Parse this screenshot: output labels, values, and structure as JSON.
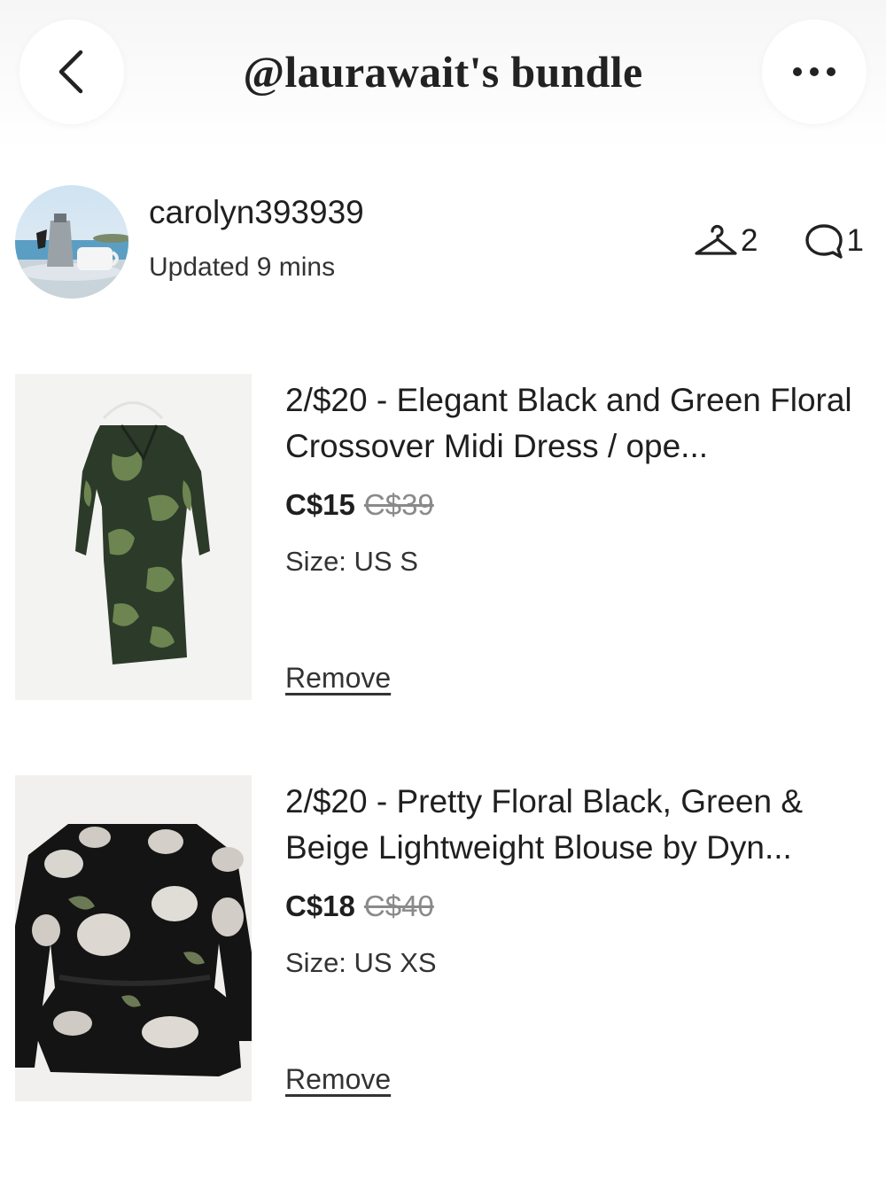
{
  "header": {
    "title": "@laurawait's bundle",
    "back_icon": "chevron-left-icon",
    "more_icon": "more-horizontal-icon"
  },
  "seller": {
    "username": "carolyn393939",
    "updated": "Updated 9 mins"
  },
  "stats": {
    "items_icon": "hanger-icon",
    "items_count": "2",
    "comments_icon": "comment-bubble-icon",
    "comments_count": "1"
  },
  "listings": [
    {
      "title": "2/$20 - Elegant Black and Green Floral Crossover Midi Dress / ope...",
      "price": "C$15",
      "original_price": "C$39",
      "size": "Size: US S",
      "remove_label": "Remove"
    },
    {
      "title": "2/$20 - Pretty Floral Black, Green & Beige Lightweight Blouse by Dyn...",
      "price": "C$18",
      "original_price": "C$40",
      "size": "Size: US XS",
      "remove_label": "Remove"
    }
  ],
  "colors": {
    "text": "#1f1f1f",
    "muted": "#8a8a8a",
    "background": "#ffffff"
  }
}
